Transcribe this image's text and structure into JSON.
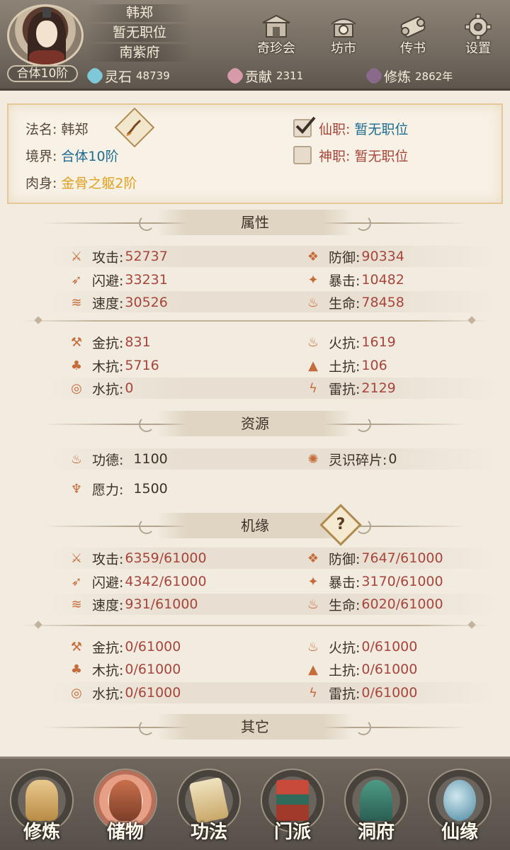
{
  "player": {
    "name": "韩郑",
    "position": "暂无职位",
    "residence": "南紫府",
    "realm": "合体10阶"
  },
  "top_menu": [
    {
      "label": "奇珍会",
      "icon": "treasure-pavilion-icon"
    },
    {
      "label": "坊市",
      "icon": "market-icon"
    },
    {
      "label": "传书",
      "icon": "scroll-icon"
    },
    {
      "label": "设置",
      "icon": "gear-icon"
    }
  ],
  "resources_bar": [
    {
      "label": "灵石",
      "value": "48739",
      "icon": "spirit-stone-icon",
      "color": "#7fc8d8"
    },
    {
      "label": "贡献",
      "value": "2311",
      "icon": "contribution-icon",
      "color": "#d79aa8"
    },
    {
      "label": "修炼",
      "value": "2862年",
      "icon": "cultivation-icon",
      "color": "#8a6a8c"
    }
  ],
  "info": {
    "dharma_name_label": "法名:",
    "dharma_name": "韩郑",
    "realm_label": "境界:",
    "realm": "合体10阶",
    "body_label": "肉身:",
    "body": "金骨之躯2阶",
    "immortal_post_label": "仙职:",
    "immortal_post": "暂无职位",
    "immortal_post_checked": true,
    "divine_post_label": "神职:",
    "divine_post": "暂无职位",
    "divine_post_checked": false
  },
  "sections": {
    "attributes": "属性",
    "resources": "资源",
    "fortune": "机缘",
    "others": "其它"
  },
  "attributes": {
    "combat": [
      {
        "label": "攻击:",
        "value": "52737",
        "icon": "attack-icon"
      },
      {
        "label": "防御:",
        "value": "90334",
        "icon": "defense-icon"
      },
      {
        "label": "闪避:",
        "value": "33231",
        "icon": "dodge-icon"
      },
      {
        "label": "暴击:",
        "value": "10482",
        "icon": "critical-icon"
      },
      {
        "label": "速度:",
        "value": "30526",
        "icon": "speed-icon"
      },
      {
        "label": "生命:",
        "value": "78458",
        "icon": "life-icon"
      }
    ],
    "resist": [
      {
        "label": "金抗:",
        "value": "831",
        "icon": "metal-resist-icon"
      },
      {
        "label": "火抗:",
        "value": "1619",
        "icon": "fire-resist-icon"
      },
      {
        "label": "木抗:",
        "value": "5716",
        "icon": "wood-resist-icon"
      },
      {
        "label": "土抗:",
        "value": "106",
        "icon": "earth-resist-icon"
      },
      {
        "label": "水抗:",
        "value": "0",
        "icon": "water-resist-icon"
      },
      {
        "label": "雷抗:",
        "value": "2129",
        "icon": "thunder-resist-icon"
      }
    ]
  },
  "resources": [
    {
      "label": "功德:",
      "value": "1100",
      "icon": "merit-icon"
    },
    {
      "label": "灵识碎片:",
      "value": "0",
      "icon": "soul-fragment-icon"
    },
    {
      "label": "愿力:",
      "value": "1500",
      "icon": "wish-power-icon"
    }
  ],
  "fortune": {
    "help_label": "?",
    "combat": [
      {
        "label": "攻击:",
        "value": "6359/61000",
        "icon": "attack-icon"
      },
      {
        "label": "防御:",
        "value": "7647/61000",
        "icon": "defense-icon"
      },
      {
        "label": "闪避:",
        "value": "4342/61000",
        "icon": "dodge-icon"
      },
      {
        "label": "暴击:",
        "value": "3170/61000",
        "icon": "critical-icon"
      },
      {
        "label": "速度:",
        "value": "931/61000",
        "icon": "speed-icon"
      },
      {
        "label": "生命:",
        "value": "6020/61000",
        "icon": "life-icon"
      }
    ],
    "resist": [
      {
        "label": "金抗:",
        "value": "0/61000",
        "icon": "metal-resist-icon"
      },
      {
        "label": "火抗:",
        "value": "0/61000",
        "icon": "fire-resist-icon"
      },
      {
        "label": "木抗:",
        "value": "0/61000",
        "icon": "wood-resist-icon"
      },
      {
        "label": "土抗:",
        "value": "0/61000",
        "icon": "earth-resist-icon"
      },
      {
        "label": "水抗:",
        "value": "0/61000",
        "icon": "water-resist-icon"
      },
      {
        "label": "雷抗:",
        "value": "0/61000",
        "icon": "thunder-resist-icon"
      }
    ]
  },
  "bottom_nav": [
    {
      "label": "修炼",
      "icon": "cultivate-icon",
      "active": false
    },
    {
      "label": "储物",
      "icon": "storage-bag-icon",
      "active": true
    },
    {
      "label": "功法",
      "icon": "technique-book-icon",
      "active": false
    },
    {
      "label": "门派",
      "icon": "sect-gate-icon",
      "active": false
    },
    {
      "label": "洞府",
      "icon": "cave-dwelling-icon",
      "active": false
    },
    {
      "label": "仙缘",
      "icon": "immortal-fate-icon",
      "active": false
    }
  ],
  "colors": {
    "value_red": "#a8453b",
    "post_blue": "#1f6c91",
    "body_gold": "#e0a020",
    "panel_border": "#e5c898"
  }
}
